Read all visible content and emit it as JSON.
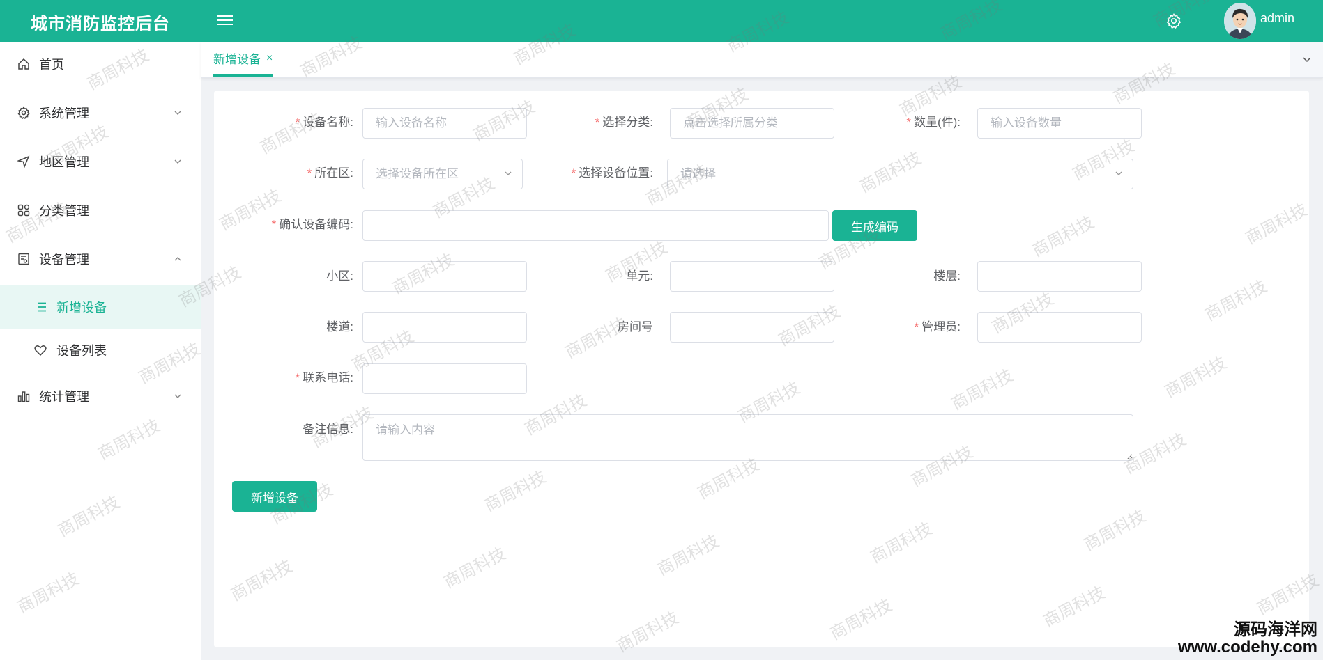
{
  "header": {
    "title": "城市消防监控后台",
    "user": "admin"
  },
  "sidebar": {
    "items": [
      {
        "label": "首页",
        "icon": "home-icon"
      },
      {
        "label": "系统管理",
        "icon": "gear-icon"
      },
      {
        "label": "地区管理",
        "icon": "navigation-icon"
      },
      {
        "label": "分类管理",
        "icon": "grid-icon"
      },
      {
        "label": "设备管理",
        "icon": "device-icon"
      },
      {
        "label": "新增设备",
        "icon": "list-icon"
      },
      {
        "label": "设备列表",
        "icon": "heart-icon"
      },
      {
        "label": "统计管理",
        "icon": "bar-chart-icon"
      }
    ]
  },
  "tabs": {
    "active": "新增设备",
    "close": "×"
  },
  "form": {
    "device_name": {
      "label": "设备名称:",
      "placeholder": "输入设备名称"
    },
    "category": {
      "label": "选择分类:",
      "placeholder": "点击选择所属分类"
    },
    "quantity": {
      "label": "数量(件):",
      "placeholder": "输入设备数量"
    },
    "district": {
      "label": "所在区:",
      "placeholder": "选择设备所在区"
    },
    "location": {
      "label": "选择设备位置:",
      "placeholder": "请选择"
    },
    "code": {
      "label": "确认设备编码:",
      "button": "生成编码"
    },
    "community": {
      "label": "小区:"
    },
    "unit": {
      "label": "单元:"
    },
    "floor": {
      "label": "楼层:"
    },
    "building": {
      "label": "楼道:"
    },
    "room": {
      "label": "房间号"
    },
    "admin": {
      "label": "管理员:"
    },
    "phone": {
      "label": "联系电话:"
    },
    "remark": {
      "label": "备注信息:",
      "placeholder": "请输入内容"
    },
    "submit": "新增设备"
  },
  "watermark": {
    "text": "商周科技",
    "site_name": "源码海洋网",
    "site_url": "www.codehy.com"
  },
  "colors": {
    "primary": "#1ab394",
    "required": "#f56c6c"
  }
}
